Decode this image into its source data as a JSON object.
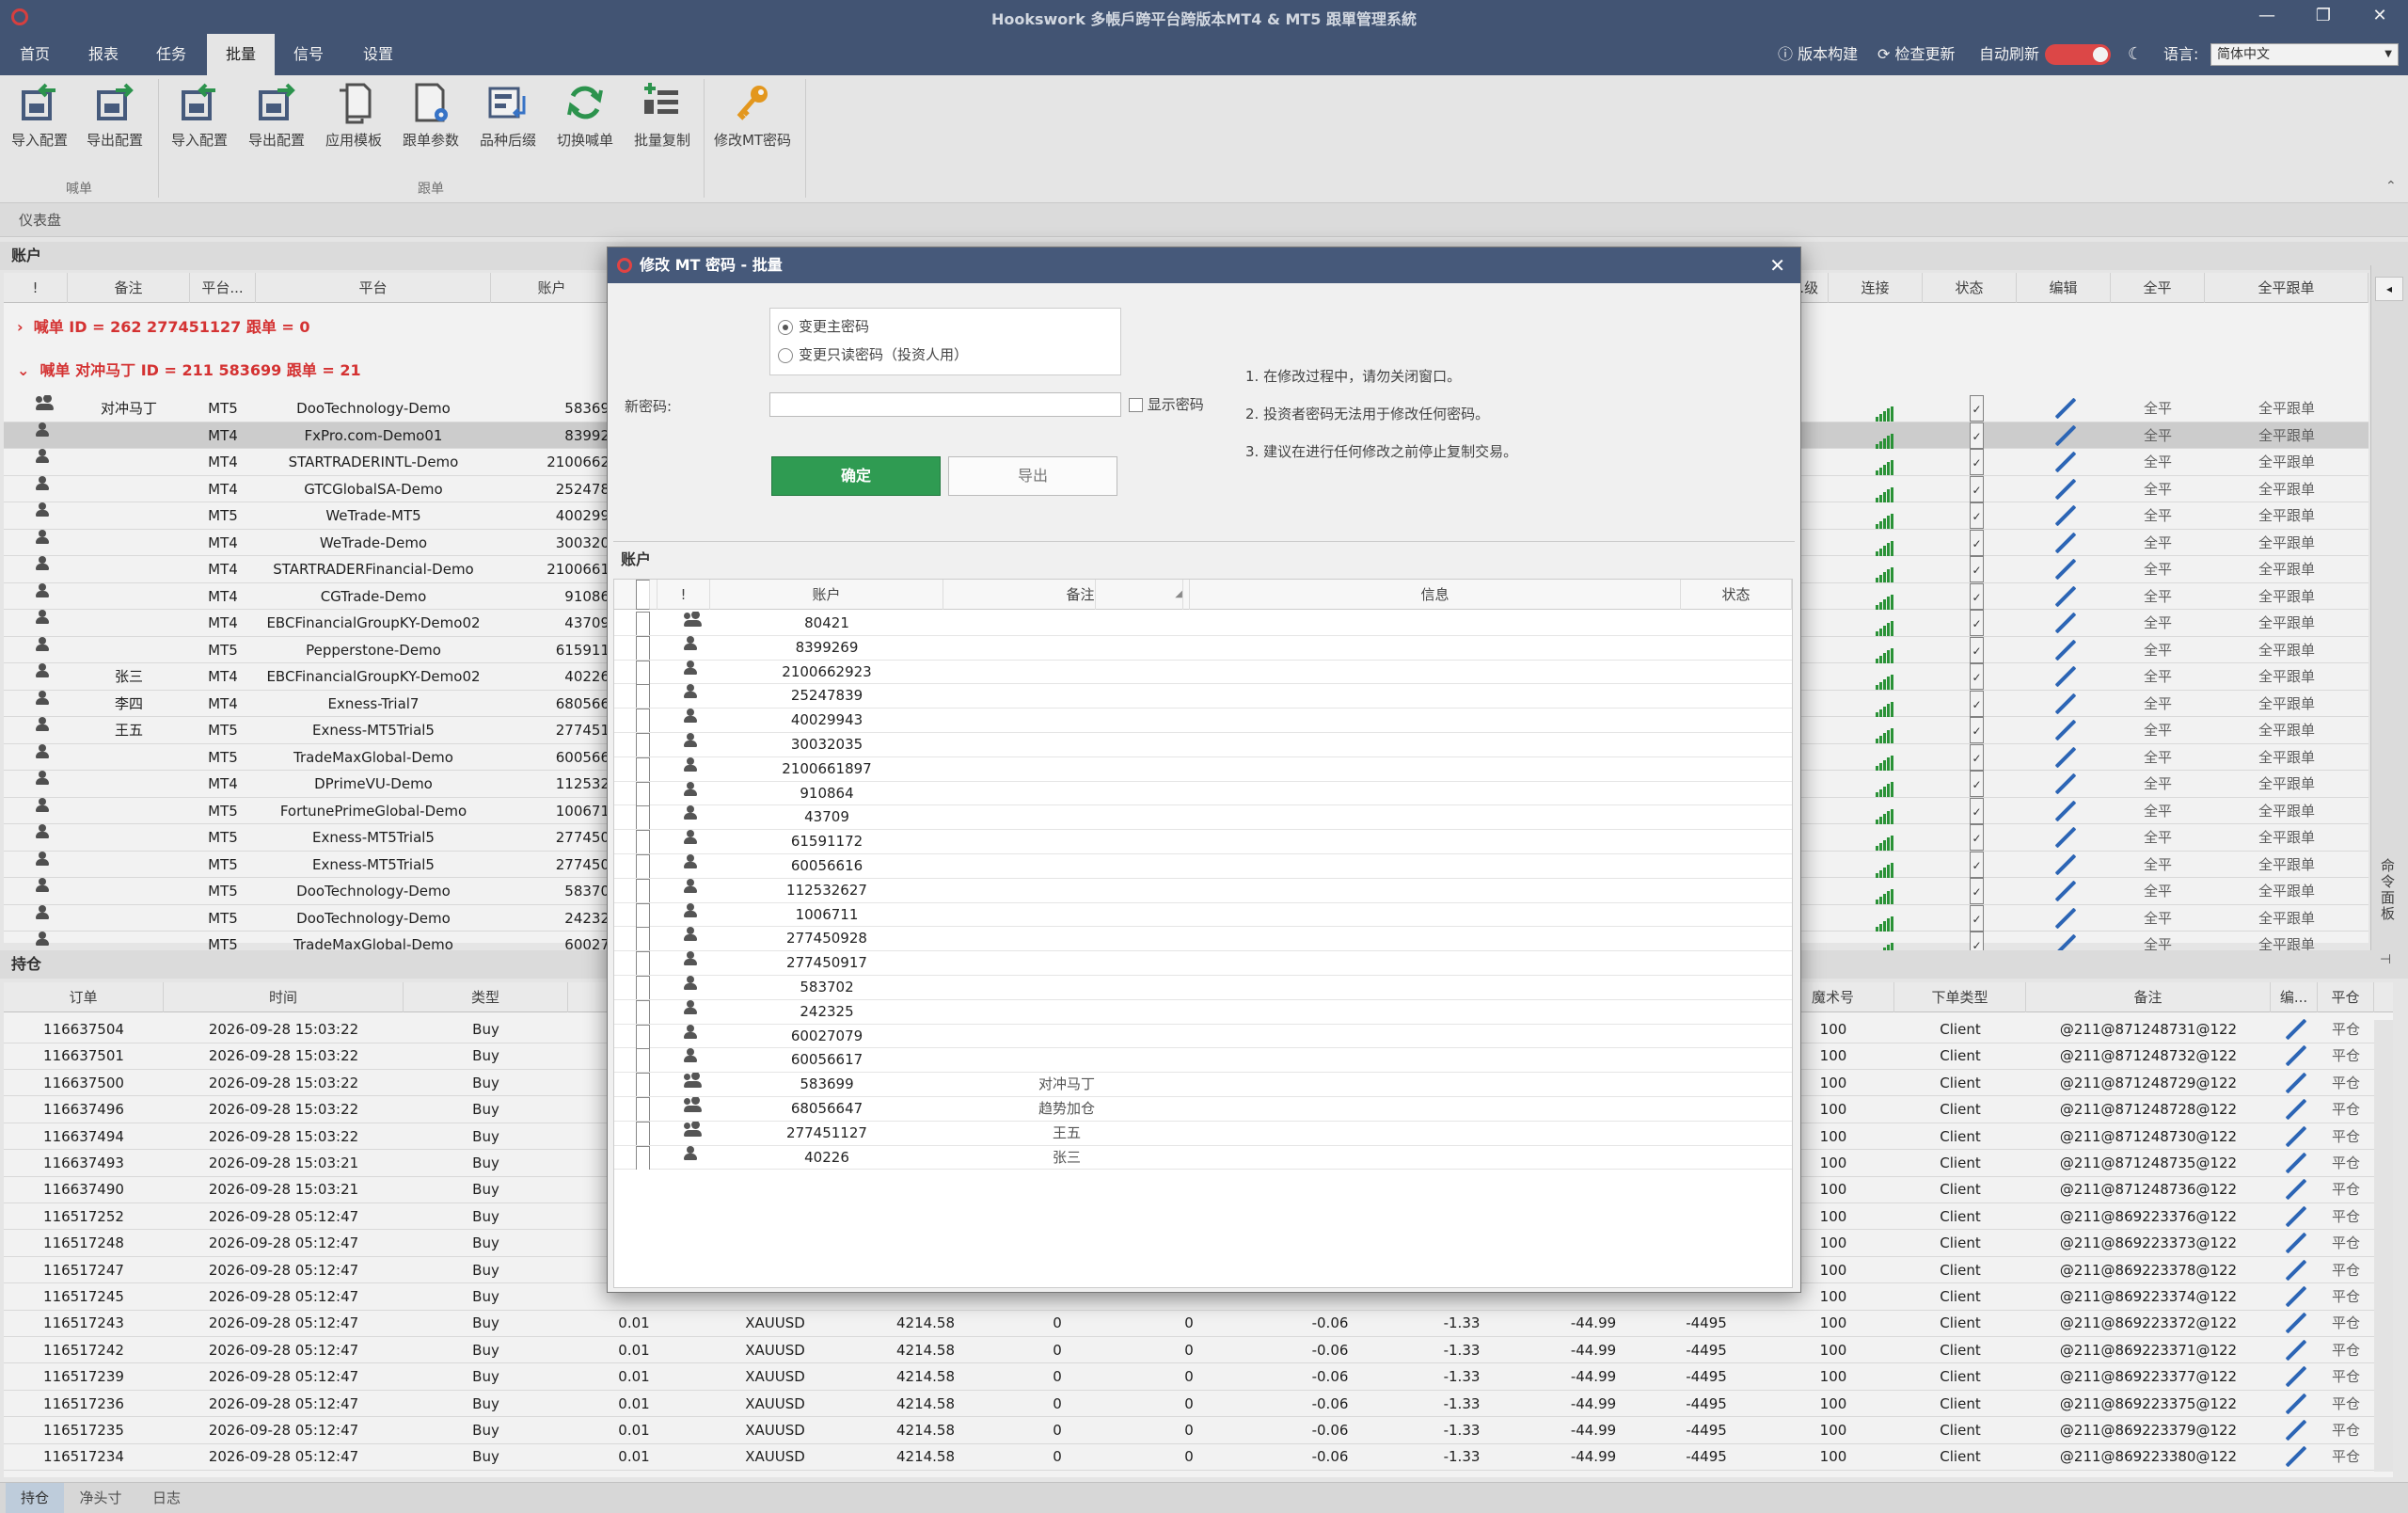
{
  "window": {
    "title": "Hookswork 多帳戶跨平台跨版本MT4 & MT5 跟單管理系統",
    "controls": [
      "—",
      "❐",
      "✕"
    ]
  },
  "menu": {
    "tabs": [
      "首页",
      "报表",
      "任务",
      "批量",
      "信号",
      "设置"
    ],
    "active": 3,
    "version_build": "版本构建",
    "check_update": "检查更新",
    "auto_refresh": "自动刷新",
    "language_label": "语言:",
    "language_value": "简体中文"
  },
  "ribbon": {
    "buttons": [
      {
        "label": "导入配置",
        "icon": "import-config-icon"
      },
      {
        "label": "导出配置",
        "icon": "export-config-icon"
      },
      {
        "label": "导入配置",
        "icon": "import-config-icon"
      },
      {
        "label": "导出配置",
        "icon": "export-config-icon"
      },
      {
        "label": "应用模板",
        "icon": "apply-template-icon"
      },
      {
        "label": "跟单参数",
        "icon": "copy-params-icon"
      },
      {
        "label": "品种后缀",
        "icon": "symbol-suffix-icon"
      },
      {
        "label": "切换喊单",
        "icon": "switch-signal-icon"
      },
      {
        "label": "批量复制",
        "icon": "batch-copy-icon"
      },
      {
        "label": "修改MT密码",
        "icon": "key-icon"
      }
    ],
    "groups": [
      "喊单",
      "跟单"
    ]
  },
  "dashboard_label": "仪表盘",
  "accounts": {
    "title": "账户",
    "headers": [
      "!",
      "备注",
      "平台...",
      "平台",
      "账户"
    ],
    "right_headers": [
      "...级",
      "连接",
      "状态",
      "编辑",
      "全平",
      "全平跟单"
    ],
    "groups": [
      {
        "text": "喊单   ID = 262 277451127  跟单 = 0",
        "expanded": false
      },
      {
        "text": "喊单  对冲马丁 ID = 211 583699  跟单 = 21",
        "expanded": true
      }
    ],
    "rows": [
      {
        "icon": "group",
        "note": "对冲马丁",
        "plat": "MT5",
        "server": "DooTechnology-Demo",
        "acct": "58369"
      },
      {
        "icon": "person",
        "note": "",
        "plat": "MT4",
        "server": "FxPro.com-Demo01",
        "acct": "83992",
        "selected": true
      },
      {
        "icon": "person",
        "note": "",
        "plat": "MT4",
        "server": "STARTRADERINTL-Demo",
        "acct": "2100662"
      },
      {
        "icon": "person",
        "note": "",
        "plat": "MT4",
        "server": "GTCGlobalSA-Demo",
        "acct": "252478"
      },
      {
        "icon": "person",
        "note": "",
        "plat": "MT5",
        "server": "WeTrade-MT5",
        "acct": "400299"
      },
      {
        "icon": "person",
        "note": "",
        "plat": "MT4",
        "server": "WeTrade-Demo",
        "acct": "300320"
      },
      {
        "icon": "person",
        "note": "",
        "plat": "MT4",
        "server": "STARTRADERFinancial-Demo",
        "acct": "2100661"
      },
      {
        "icon": "person",
        "note": "",
        "plat": "MT4",
        "server": "CGTrade-Demo",
        "acct": "91086"
      },
      {
        "icon": "person",
        "note": "",
        "plat": "MT4",
        "server": "EBCFinancialGroupKY-Demo02",
        "acct": "43709"
      },
      {
        "icon": "person",
        "note": "",
        "plat": "MT5",
        "server": "Pepperstone-Demo",
        "acct": "615911"
      },
      {
        "icon": "person",
        "note": "张三",
        "plat": "MT4",
        "server": "EBCFinancialGroupKY-Demo02",
        "acct": "40226"
      },
      {
        "icon": "person",
        "note": "李四",
        "plat": "MT4",
        "server": "Exness-Trial7",
        "acct": "680566"
      },
      {
        "icon": "person",
        "note": "王五",
        "plat": "MT5",
        "server": "Exness-MT5Trial5",
        "acct": "277451"
      },
      {
        "icon": "person",
        "note": "",
        "plat": "MT5",
        "server": "TradeMaxGlobal-Demo",
        "acct": "600566"
      },
      {
        "icon": "person",
        "note": "",
        "plat": "MT4",
        "server": "DPrimeVU-Demo",
        "acct": "112532"
      },
      {
        "icon": "person",
        "note": "",
        "plat": "MT5",
        "server": "FortunePrimeGlobal-Demo",
        "acct": "100671"
      },
      {
        "icon": "person",
        "note": "",
        "plat": "MT5",
        "server": "Exness-MT5Trial5",
        "acct": "277450"
      },
      {
        "icon": "person",
        "note": "",
        "plat": "MT5",
        "server": "Exness-MT5Trial5",
        "acct": "277450"
      },
      {
        "icon": "person",
        "note": "",
        "plat": "MT5",
        "server": "DooTechnology-Demo",
        "acct": "58370"
      },
      {
        "icon": "person",
        "note": "",
        "plat": "MT5",
        "server": "DooTechnology-Demo",
        "acct": "24232"
      },
      {
        "icon": "person",
        "note": "",
        "plat": "MT5",
        "server": "TradeMaxGlobal-Demo",
        "acct": "60027"
      }
    ],
    "close_label": "全平",
    "close_copy_label": "全平跟单"
  },
  "positions": {
    "title": "持仓",
    "headers": [
      "订单",
      "时间",
      "类型"
    ],
    "right_headers": [
      "魔术号",
      "下单类型",
      "备注",
      "编...",
      "平仓"
    ],
    "mid_headers": [
      "",
      "",
      "",
      "",
      "",
      "",
      "",
      "",
      ""
    ],
    "rows": [
      {
        "order": "116637504",
        "time": "2026-09-28 15:03:22",
        "type": "Buy",
        "magic": "100",
        "otype": "Client",
        "note": "@211@871248731@122"
      },
      {
        "order": "116637501",
        "time": "2026-09-28 15:03:22",
        "type": "Buy",
        "magic": "100",
        "otype": "Client",
        "note": "@211@871248732@122"
      },
      {
        "order": "116637500",
        "time": "2026-09-28 15:03:22",
        "type": "Buy",
        "magic": "100",
        "otype": "Client",
        "note": "@211@871248729@122"
      },
      {
        "order": "116637496",
        "time": "2026-09-28 15:03:22",
        "type": "Buy",
        "magic": "100",
        "otype": "Client",
        "note": "@211@871248728@122"
      },
      {
        "order": "116637494",
        "time": "2026-09-28 15:03:22",
        "type": "Buy",
        "magic": "100",
        "otype": "Client",
        "note": "@211@871248730@122"
      },
      {
        "order": "116637493",
        "time": "2026-09-28 15:03:21",
        "type": "Buy",
        "magic": "100",
        "otype": "Client",
        "note": "@211@871248735@122"
      },
      {
        "order": "116637490",
        "time": "2026-09-28 15:03:21",
        "type": "Buy",
        "magic": "100",
        "otype": "Client",
        "note": "@211@871248736@122"
      },
      {
        "order": "116517252",
        "time": "2026-09-28 05:12:47",
        "type": "Buy",
        "magic": "100",
        "otype": "Client",
        "note": "@211@869223376@122"
      },
      {
        "order": "116517248",
        "time": "2026-09-28 05:12:47",
        "type": "Buy",
        "magic": "100",
        "otype": "Client",
        "note": "@211@869223373@122"
      },
      {
        "order": "116517247",
        "time": "2026-09-28 05:12:47",
        "type": "Buy",
        "magic": "100",
        "otype": "Client",
        "note": "@211@869223378@122"
      },
      {
        "order": "116517245",
        "time": "2026-09-28 05:12:47",
        "type": "Buy",
        "magic": "100",
        "otype": "Client",
        "note": "@211@869223374@122"
      },
      {
        "order": "116517243",
        "time": "2026-09-28 05:12:47",
        "type": "Buy",
        "lots": "0.01",
        "sym": "XAUUSD",
        "price": "4214.58",
        "a": "0",
        "b": "0",
        "c": "-0.06",
        "d": "-1.33",
        "e": "-44.99",
        "f": "-4495",
        "magic": "100",
        "otype": "Client",
        "note": "@211@869223372@122"
      },
      {
        "order": "116517242",
        "time": "2026-09-28 05:12:47",
        "type": "Buy",
        "lots": "0.01",
        "sym": "XAUUSD",
        "price": "4214.58",
        "a": "0",
        "b": "0",
        "c": "-0.06",
        "d": "-1.33",
        "e": "-44.99",
        "f": "-4495",
        "magic": "100",
        "otype": "Client",
        "note": "@211@869223371@122"
      },
      {
        "order": "116517239",
        "time": "2026-09-28 05:12:47",
        "type": "Buy",
        "lots": "0.01",
        "sym": "XAUUSD",
        "price": "4214.58",
        "a": "0",
        "b": "0",
        "c": "-0.06",
        "d": "-1.33",
        "e": "-44.99",
        "f": "-4495",
        "magic": "100",
        "otype": "Client",
        "note": "@211@869223377@122"
      },
      {
        "order": "116517236",
        "time": "2026-09-28 05:12:47",
        "type": "Buy",
        "lots": "0.01",
        "sym": "XAUUSD",
        "price": "4214.58",
        "a": "0",
        "b": "0",
        "c": "-0.06",
        "d": "-1.33",
        "e": "-44.99",
        "f": "-4495",
        "magic": "100",
        "otype": "Client",
        "note": "@211@869223375@122"
      },
      {
        "order": "116517235",
        "time": "2026-09-28 05:12:47",
        "type": "Buy",
        "lots": "0.01",
        "sym": "XAUUSD",
        "price": "4214.58",
        "a": "0",
        "b": "0",
        "c": "-0.06",
        "d": "-1.33",
        "e": "-44.99",
        "f": "-4495",
        "magic": "100",
        "otype": "Client",
        "note": "@211@869223379@122"
      },
      {
        "order": "116517234",
        "time": "2026-09-28 05:12:47",
        "type": "Buy",
        "lots": "0.01",
        "sym": "XAUUSD",
        "price": "4214.58",
        "a": "0",
        "b": "0",
        "c": "-0.06",
        "d": "-1.33",
        "e": "-44.99",
        "f": "-4495",
        "magic": "100",
        "otype": "Client",
        "note": "@211@869223380@122"
      }
    ],
    "close_label": "平仓"
  },
  "bottom_tabs": [
    "持仓",
    "净头寸",
    "日志"
  ],
  "side_panel_label": "命令面板",
  "dialog": {
    "title": "修改 MT 密码 - 批量",
    "radio_main": "变更主密码",
    "radio_readonly": "变更只读密码（投资人用）",
    "new_password_label": "新密码:",
    "new_password_value": "",
    "show_password": "显示密码",
    "ok": "确定",
    "export": "导出",
    "tips": [
      "1. 在修改过程中，请勿关闭窗口。",
      "2. 投资者密码无法用于修改任何密码。",
      "3. 建议在进行任何修改之前停止复制交易。"
    ],
    "accounts_title": "账户",
    "headers": [
      "!",
      "账户",
      "备注",
      "信息",
      "状态"
    ],
    "rows": [
      {
        "icon": "group",
        "acct": "80421",
        "note": ""
      },
      {
        "icon": "person",
        "acct": "8399269",
        "note": ""
      },
      {
        "icon": "person",
        "acct": "2100662923",
        "note": ""
      },
      {
        "icon": "person",
        "acct": "25247839",
        "note": ""
      },
      {
        "icon": "person",
        "acct": "40029943",
        "note": ""
      },
      {
        "icon": "person",
        "acct": "30032035",
        "note": ""
      },
      {
        "icon": "person",
        "acct": "2100661897",
        "note": ""
      },
      {
        "icon": "person",
        "acct": "910864",
        "note": ""
      },
      {
        "icon": "person",
        "acct": "43709",
        "note": ""
      },
      {
        "icon": "person",
        "acct": "61591172",
        "note": ""
      },
      {
        "icon": "person",
        "acct": "60056616",
        "note": ""
      },
      {
        "icon": "person",
        "acct": "112532627",
        "note": ""
      },
      {
        "icon": "person",
        "acct": "1006711",
        "note": ""
      },
      {
        "icon": "person",
        "acct": "277450928",
        "note": ""
      },
      {
        "icon": "person",
        "acct": "277450917",
        "note": ""
      },
      {
        "icon": "person",
        "acct": "583702",
        "note": ""
      },
      {
        "icon": "person",
        "acct": "242325",
        "note": ""
      },
      {
        "icon": "person",
        "acct": "60027079",
        "note": ""
      },
      {
        "icon": "person",
        "acct": "60056617",
        "note": ""
      },
      {
        "icon": "group",
        "acct": "583699",
        "note": "对冲马丁"
      },
      {
        "icon": "group",
        "acct": "68056647",
        "note": "趋势加仓"
      },
      {
        "icon": "group",
        "acct": "277451127",
        "note": "王五"
      },
      {
        "icon": "person",
        "acct": "40226",
        "note": "张三"
      }
    ]
  }
}
